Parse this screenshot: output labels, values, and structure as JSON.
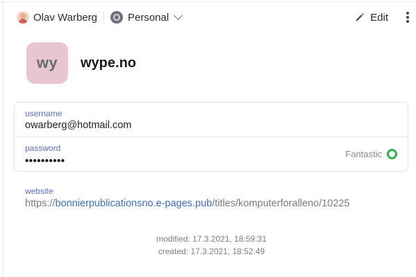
{
  "header": {
    "owner_name": "Olav Warberg",
    "vault_name": "Personal",
    "edit_label": "Edit"
  },
  "item": {
    "icon_text": "wy",
    "icon_color": "#e8c5d1",
    "title": "wype.no"
  },
  "fields": {
    "username_label": "username",
    "username_value": "owarberg@hotmail.com",
    "password_label": "password",
    "password_masked": "••••••••••",
    "password_strength": "Fantastic",
    "strength_color": "#2db34a"
  },
  "website": {
    "label": "website",
    "scheme": "https://",
    "host": "bonnierpublicationsno.e-pages.pub",
    "path": "/titles/komputerforalleno/10225"
  },
  "meta": {
    "modified": "modified: 17.3.2021, 18:59:31",
    "created": "created: 17.3.2021, 18:52:49"
  },
  "icons": [
    "avatar-icon",
    "vault-icon",
    "chevron-down-icon",
    "pencil-icon",
    "more-vertical-icon",
    "strength-ring-icon"
  ]
}
